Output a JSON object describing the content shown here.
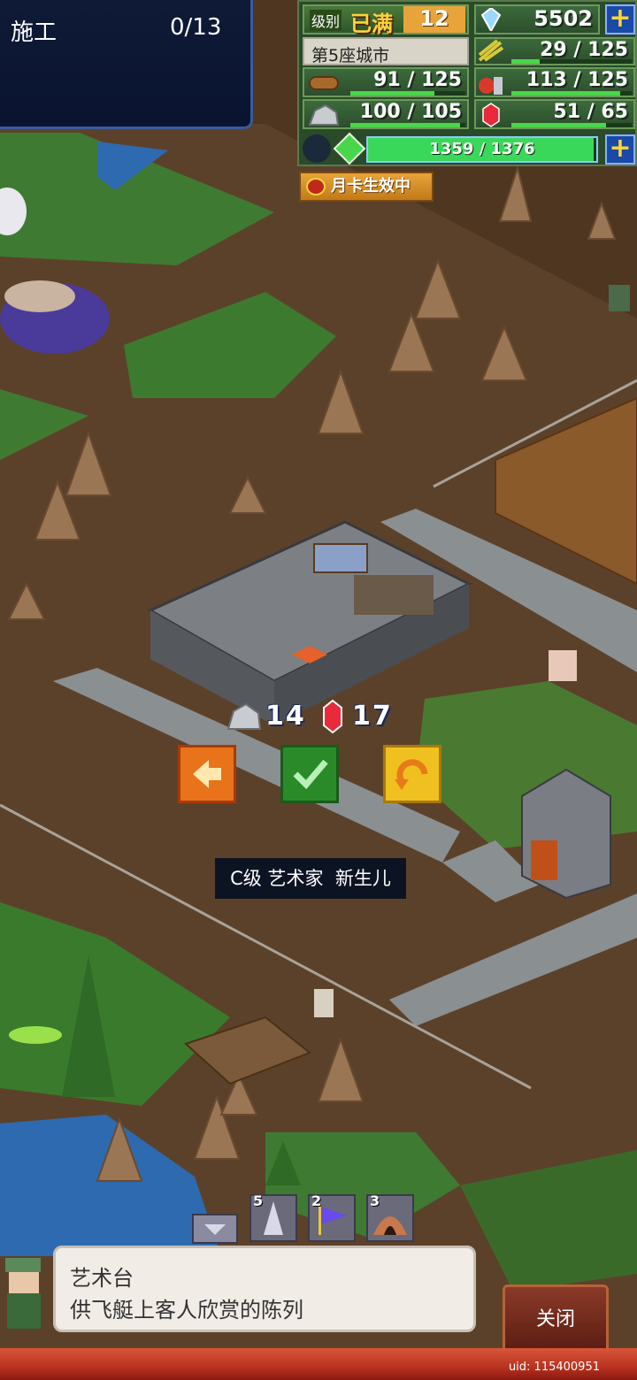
{
  "build_panel": {
    "title": "施工",
    "count": "0/13"
  },
  "resources": {
    "level_label": "级别",
    "level_value": "已满",
    "level_num": "12",
    "diamonds": "5502",
    "city_name": "第5座城市",
    "food": "29 / 125",
    "food_fill": 0.232,
    "wood": "91 / 125",
    "wood_fill": 0.728,
    "fruit": "113 / 125",
    "fruit_fill": 0.904,
    "stone": "100 / 105",
    "stone_fill": 0.952,
    "ruby": "51 / 65",
    "ruby_fill": 0.785,
    "exp": "1359 / 1376",
    "exp_fill": 0.988
  },
  "month_card": "月卡生效中",
  "cost": {
    "stone": "14",
    "ruby": "17"
  },
  "tooltip": "C级 艺术家  新生儿",
  "toolbar": {
    "tool1_num": "5",
    "tool2_num": "2",
    "tool3_num": "3"
  },
  "info": {
    "name": "艺术台",
    "desc": "供飞艇上客人欣赏的陈列"
  },
  "close_label": "关闭",
  "uid": "uid: 115400951",
  "icons": [
    "diamond-icon",
    "plus-icon",
    "wheat-icon",
    "wood-icon",
    "fruit-icon",
    "stone-icon",
    "ruby-icon",
    "green-gem-icon",
    "back-arrow-icon",
    "check-icon",
    "rotate-icon",
    "collapse-icon",
    "tower-icon",
    "flag-icon",
    "cave-icon",
    "crown-icon"
  ]
}
